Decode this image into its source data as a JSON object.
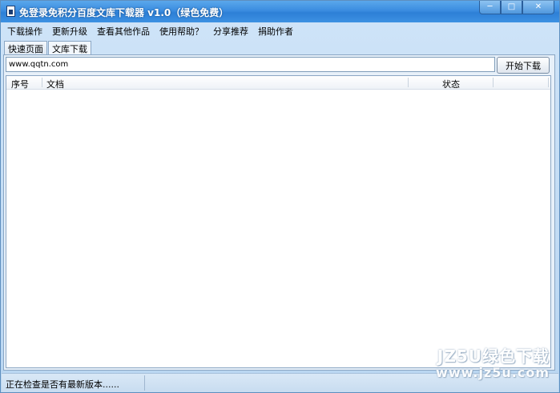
{
  "window": {
    "title": "免登录免积分百度文库下载器 v1.0（绿色免费）",
    "controls": {
      "minimize": "─",
      "maximize": "□",
      "close": "✕"
    }
  },
  "menu": {
    "items": [
      "下载操作",
      "更新升级",
      "查看其他作品",
      "使用帮助？",
      "分享推荐",
      "捐助作者"
    ]
  },
  "tabs": [
    {
      "label": "快速页面",
      "active": false
    },
    {
      "label": "文库下载",
      "active": true
    }
  ],
  "download": {
    "url_value": "www.qqtn.com",
    "start_button": "开始下载"
  },
  "table": {
    "columns": [
      "序号",
      "文档",
      "状态"
    ],
    "rows": []
  },
  "status": {
    "text": "正在检查是否有最新版本......"
  },
  "watermark": {
    "line1": "JZ5U绿色下载",
    "line2": "www.jz5u.com"
  }
}
